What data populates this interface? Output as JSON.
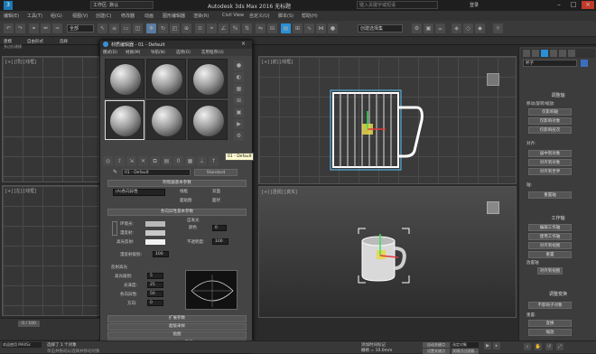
{
  "title": "Autodesk 3ds Max 2016   无标题",
  "workspace": "工作区: 默认",
  "search_placeholder": "键入关键字或短语",
  "user": "登录",
  "menus": [
    "编辑(E)",
    "工具(T)",
    "组(G)",
    "视图(V)",
    "创建(C)",
    "修改器",
    "动画",
    "图形编辑器",
    "渲染(R)",
    "Civil View",
    "自定义(U)",
    "脚本(S)",
    "帮助(H)"
  ],
  "ribbon": {
    "tab1": "建模",
    "tab2": "自由形式",
    "tab3": "选择",
    "tab4": "对象绘制",
    "tab5": "填充",
    "sub": "多边形建模"
  },
  "selection_filter": "全部",
  "named_selection": "创建选择集",
  "viewports": {
    "top": "[+] [顶] [线框]",
    "front": "[+] [前] [线框]",
    "left": "[+] [左] [线框]",
    "persp_top": "[+] [前] [线框]",
    "persp": "[+] [透视] [真实]"
  },
  "mat_editor": {
    "title": "材质编辑器 - 01 - Default",
    "menu": [
      "模式(D)",
      "材质(M)",
      "导航(N)",
      "选项(O)",
      "实用程序(U)"
    ],
    "tooltip": "01 - Default",
    "material_name": "01 - Default",
    "material_type": "Standard",
    "rollout1": "明暗器基本参数",
    "shader": "(A)各向异性",
    "opts": [
      "线框",
      "双面",
      "面贴图",
      "面状"
    ],
    "rollout2": "各向异性基本参数",
    "self_illum": "自发光",
    "color_label": "颜色",
    "color_value": "0",
    "ambient": "环境光:",
    "diffuse": "漫反射:",
    "specular": "高光反射:",
    "opacity": "不透明度:",
    "opacity_value": "100",
    "diffuse_level": "漫反射级别:",
    "diffuse_level_value": "100",
    "spec_high": "反射高光",
    "spec_level": "高光级别:",
    "spec_level_value": "5",
    "gloss": "光泽度:",
    "gloss_value": "25",
    "aniso": "各向异性:",
    "aniso_value": "50",
    "orient": "方向:",
    "orient_value": "0",
    "rollouts": [
      "扩展参数",
      "超级采样",
      "贴图",
      "mental ray 连接"
    ]
  },
  "cmd": {
    "name": "杯子",
    "sec1": "调整轴",
    "b1": "移动/旋转/缩放:",
    "b2": "仅影响轴",
    "b3": "仅影响对象",
    "b4": "仅影响层次",
    "sec2": "对齐:",
    "b5": "居中到对象",
    "b6": "对齐到对象",
    "b7": "对齐到世界",
    "sec3": "轴:",
    "b8": "重置轴",
    "sec4": "工作轴",
    "b9": "编辑工作轴",
    "b10": "使用工作轴",
    "b11": "对齐到视图",
    "b12": "重置",
    "b13": "放置轴",
    "b14": "对齐到视图",
    "sec5": "调整变换",
    "b15": "不影响子对象",
    "b16": "重置:",
    "b17": "变换",
    "b18": "缩放"
  },
  "status": {
    "selected": "选择了 1 个对象",
    "hint": "单击并拖动以选择并移动对象",
    "welcome": "欢迎使用 MAXSc",
    "grid": "栅格 = 10.0mm",
    "autokey": "自动关键点",
    "setkey": "设置关键点",
    "filter": "选定对象",
    "keyfilter": "关键点过滤器...",
    "addtime": "添加时间标记",
    "frame": "0 / 100"
  },
  "colors": {
    "accent": "#2a8fd6",
    "bg": "#2b2b2b",
    "object": "#e8e8e8"
  }
}
